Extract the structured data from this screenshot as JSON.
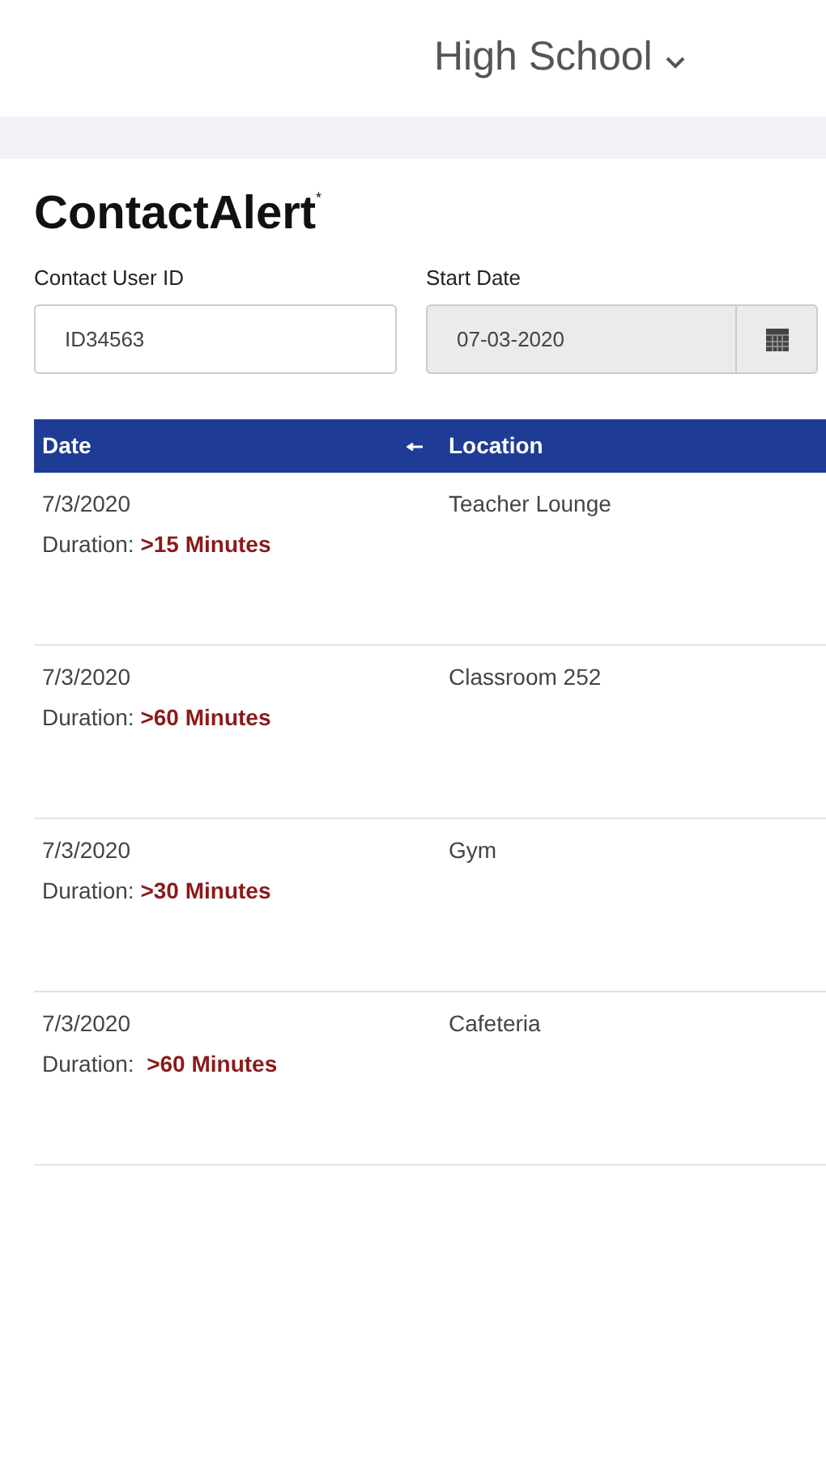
{
  "header": {
    "school_selector": "High School"
  },
  "app_title": "ContactAlert",
  "trademark": "*",
  "fields": [
    {
      "label": "Contact User ID",
      "value": "ID34563",
      "disabled": false,
      "kind": "text"
    },
    {
      "label": "Start Date",
      "value": "07-03-2020",
      "disabled": true,
      "kind": "date"
    }
  ],
  "table": {
    "columns": [
      "Date",
      "Location"
    ],
    "rows": [
      {
        "date": "7/3/2020",
        "duration_label": "Duration:",
        "duration": ">15 Minutes",
        "location": "Teacher Lounge"
      },
      {
        "date": "7/3/2020",
        "duration_label": "Duration:",
        "duration": ">60 Minutes",
        "location": "Classroom 252"
      },
      {
        "date": "7/3/2020",
        "duration_label": "Duration:",
        "duration": ">30 Minutes",
        "location": "Gym"
      },
      {
        "date": "7/3/2020",
        "duration_label": "Duration: ",
        "duration": ">60 Minutes",
        "location": "Cafeteria"
      }
    ]
  }
}
